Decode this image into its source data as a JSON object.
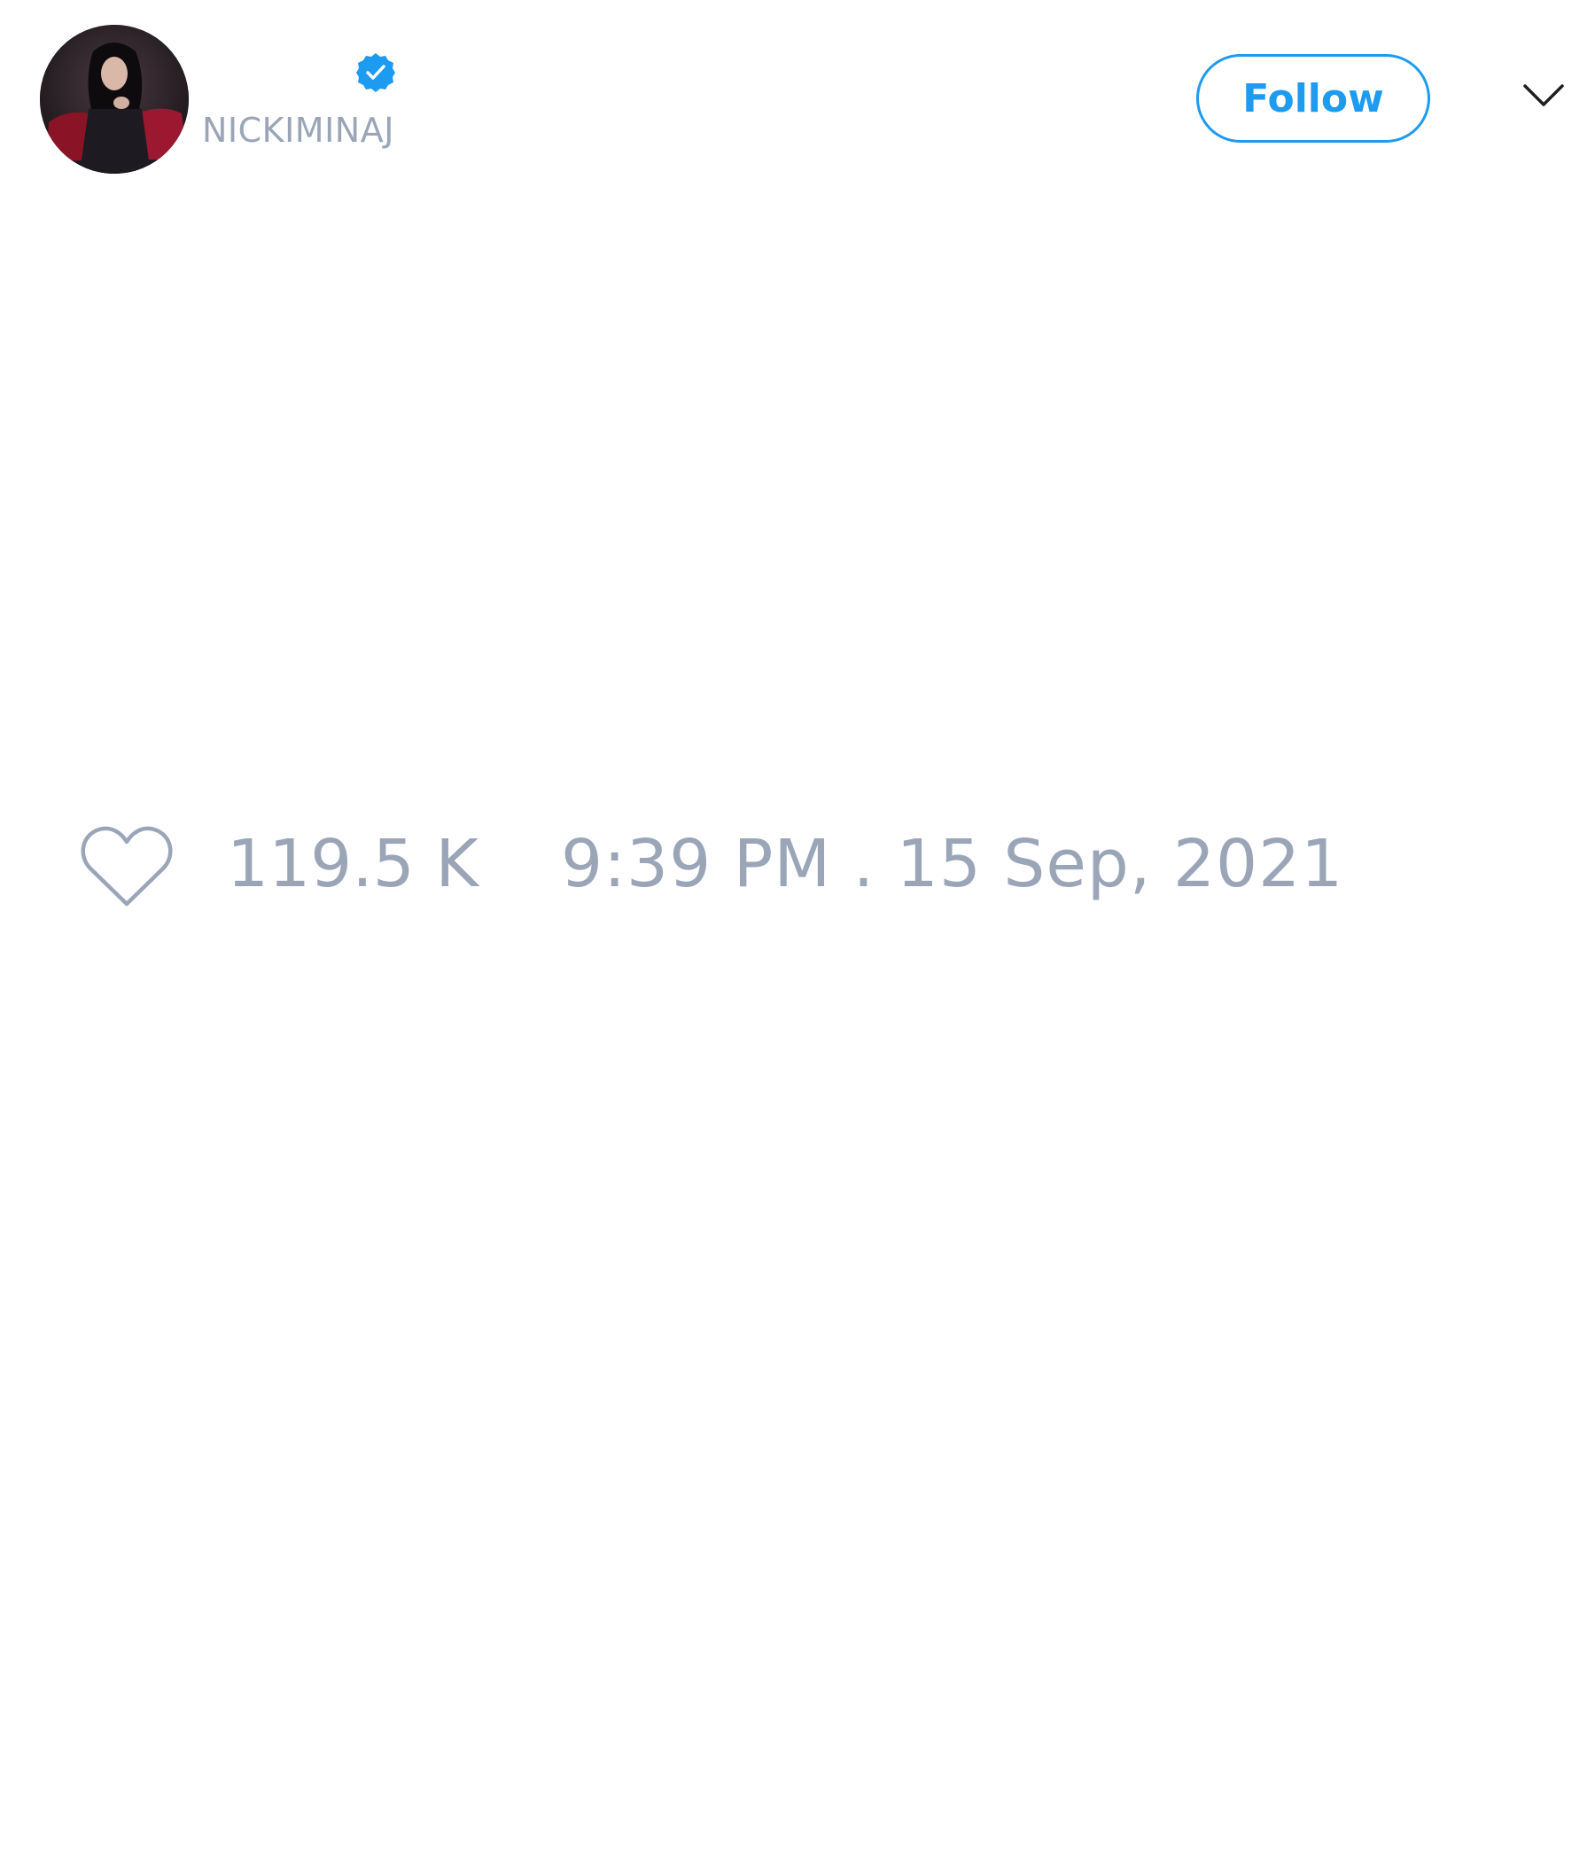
{
  "user": {
    "handle": "NICKIMINAJ",
    "verified": true
  },
  "actions": {
    "follow_label": "Follow"
  },
  "stats": {
    "likes": "119.5 K"
  },
  "meta": {
    "timestamp": "9:39 PM . 15 Sep, 2021"
  },
  "icons": {
    "verified": "verified-badge-icon",
    "like": "heart-icon",
    "menu": "chevron-down-icon"
  },
  "colors": {
    "accent": "#1d9bf0",
    "muted_text": "#9aa6b8",
    "background": "#ffffff"
  }
}
